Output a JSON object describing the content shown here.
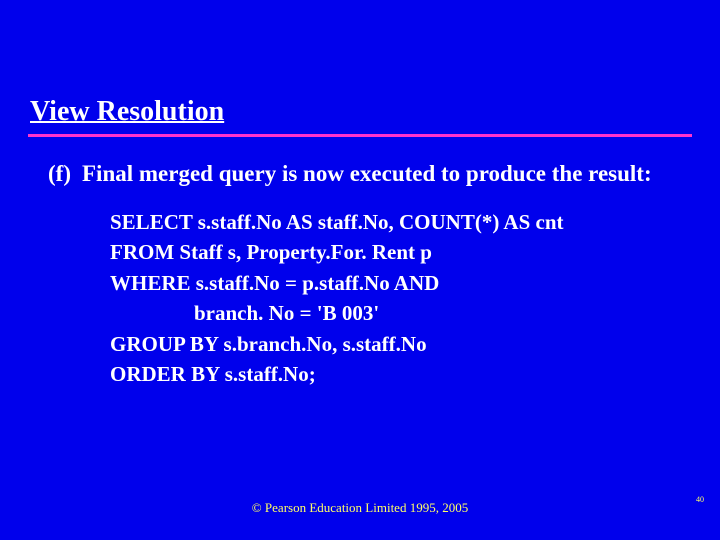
{
  "title": "View Resolution",
  "item": {
    "marker": "(f)",
    "text": "Final merged query is now executed to produce the result:"
  },
  "sql": {
    "l1": "SELECT s.staff.No AS staff.No, COUNT(*) AS cnt",
    "l2": "FROM Staff s, Property.For. Rent p",
    "l3": "WHERE s.staff.No = p.staff.No AND",
    "l4": "                branch. No = 'B 003'",
    "l5": "GROUP BY s.branch.No, s.staff.No",
    "l6": "ORDER BY s.staff.No;"
  },
  "footer": "© Pearson Education Limited 1995, 2005",
  "page_number": "40"
}
